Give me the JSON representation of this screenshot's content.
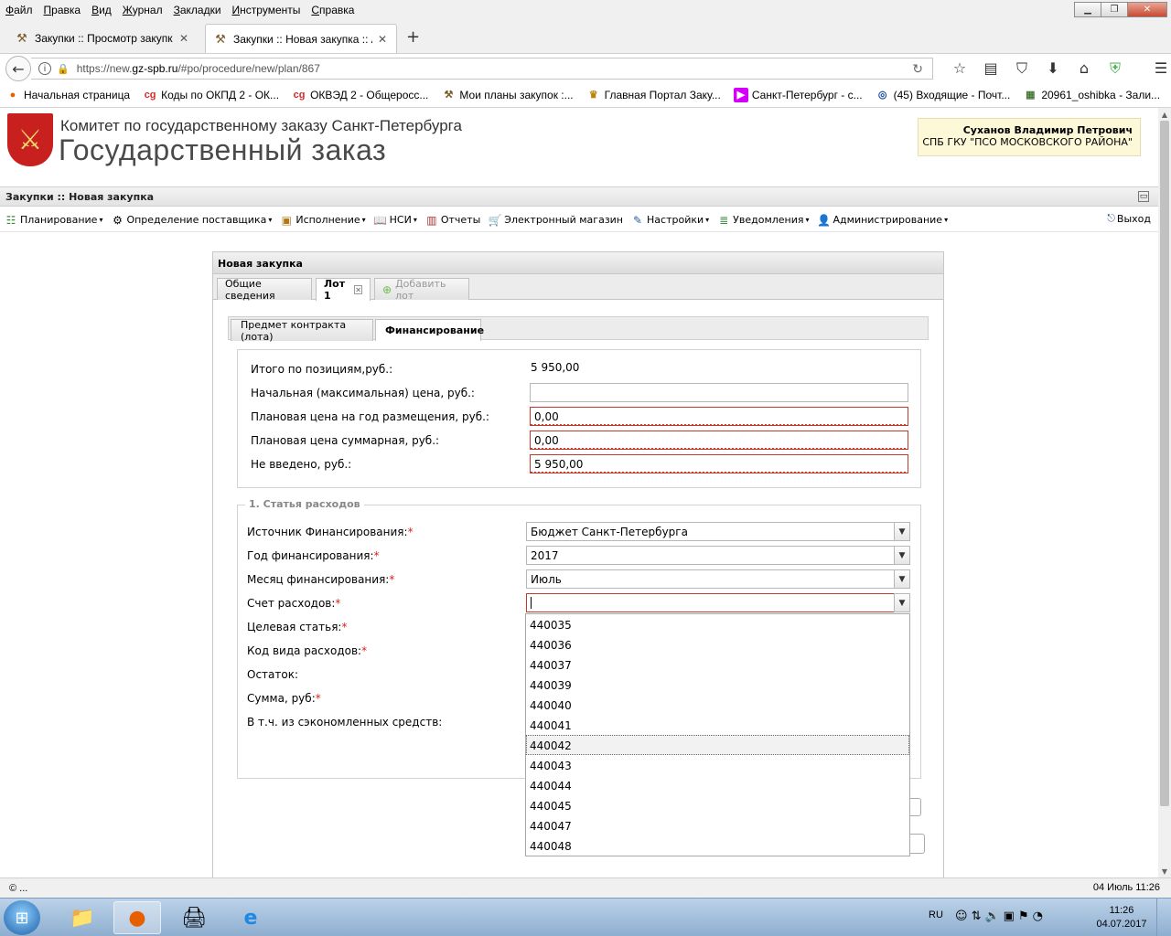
{
  "browser": {
    "menu": [
      "Файл",
      "Правка",
      "Вид",
      "Журнал",
      "Закладки",
      "Инструменты",
      "Справка"
    ],
    "tabs": [
      {
        "title": "Закупки :: Просмотр закупк",
        "active": false
      },
      {
        "title": "Закупки :: Новая закупка :: А",
        "active": true
      }
    ],
    "url_prefix": "https://new.",
    "url_domain": "gz-spb.ru",
    "url_path": "/#po/procedure/new/plan/867",
    "bookmarks": [
      {
        "label": "Начальная страница",
        "icon": "firefox-icon"
      },
      {
        "label": "Коды по ОКПД 2 - ОК...",
        "icon": "cg-icon"
      },
      {
        "label": "ОКВЭД 2 - Общеросс...",
        "icon": "cg-icon"
      },
      {
        "label": "Мои планы закупок :...",
        "icon": "gavel-icon"
      },
      {
        "label": "Главная Портал Заку...",
        "icon": "emblem-icon"
      },
      {
        "label": "Санкт-Петербург - с...",
        "icon": "play-icon"
      },
      {
        "label": "(45) Входящие - Почт...",
        "icon": "mail-icon"
      },
      {
        "label": "20961_oshibka - Зали...",
        "icon": "image-icon"
      }
    ]
  },
  "header": {
    "org_name": "Комитет по государственному заказу Санкт-Петербурга",
    "site_title": "Государственный заказ",
    "user_name": "Суханов Владимир Петрович",
    "user_org": "СПБ ГКУ \"ПСО МОСКОВСКОГО РАЙОНА\""
  },
  "panel_title": "Закупки :: Новая закупка",
  "toolbar": {
    "items": [
      "Планирование",
      "Определение поставщика",
      "Исполнение",
      "НСИ",
      "Отчеты",
      "Электронный магазин",
      "Настройки",
      "Уведомления",
      "Администрирование"
    ],
    "logout": "Выход"
  },
  "form": {
    "title": "Новая закупка",
    "outer_tabs": [
      "Общие сведения",
      "Лот 1",
      "Добавить лот"
    ],
    "inner_tabs": [
      "Предмет контракта (лота)",
      "Финансирование"
    ],
    "totals": {
      "total_label": "Итого по позициям,руб.:",
      "total_value": "5 950,00",
      "nmc_label": "Начальная (максимальная) цена, руб.:",
      "nmc_value": "",
      "year_price_label": "Плановая цена на год размещения, руб.:",
      "year_price_value": "0,00",
      "sum_price_label": "Плановая цена суммарная, руб.:",
      "sum_price_value": "0,00",
      "not_entered_label": "Не введено, руб.:",
      "not_entered_value": "5 950,00"
    },
    "expense": {
      "legend": "1. Статья расходов",
      "source_label": "Источник Финансирования:",
      "source_value": "Бюджет Санкт-Петербурга",
      "year_label": "Год финансирования:",
      "year_value": "2017",
      "month_label": "Месяц финансирования:",
      "month_value": "Июль",
      "account_label": "Счет расходов:",
      "account_value": "",
      "target_label": "Целевая статья:",
      "kind_label": "Код вида расходов:",
      "rest_label": "Остаток:",
      "amount_label": "Сумма, руб:",
      "saved_label": "В т.ч. из сэкономленных средств:",
      "required_mark": "*"
    },
    "dropdown_options": [
      "440035",
      "440036",
      "440037",
      "440039",
      "440040",
      "440041",
      "440042",
      "440043",
      "440044",
      "440045",
      "440047",
      "440048"
    ],
    "dropdown_hover": "440042"
  },
  "statusbar": {
    "left": "© ...",
    "right": "04 Июль 11:26"
  },
  "taskbar": {
    "lang": "RU",
    "time": "11:26",
    "date": "04.07.2017"
  }
}
